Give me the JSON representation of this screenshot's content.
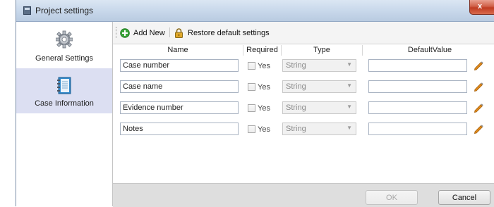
{
  "window": {
    "title": "Project settings",
    "close_label": "x"
  },
  "sidebar": {
    "items": [
      {
        "label": "General Settings",
        "icon": "gear-icon",
        "active": false
      },
      {
        "label": "Case Information",
        "icon": "notebook-icon",
        "active": true
      }
    ]
  },
  "toolbar": {
    "add_label": "Add New",
    "restore_label": "Restore default settings"
  },
  "grid": {
    "columns": [
      "Name",
      "Required",
      "Type",
      "DefaultValue"
    ],
    "rows": [
      {
        "name": "Case number",
        "required_label": "Yes",
        "type": "String",
        "default": ""
      },
      {
        "name": "Case name",
        "required_label": "Yes",
        "type": "String",
        "default": ""
      },
      {
        "name": "Evidence number",
        "required_label": "Yes",
        "type": "String",
        "default": ""
      },
      {
        "name": "Notes",
        "required_label": "Yes",
        "type": "String",
        "default": ""
      }
    ]
  },
  "footer": {
    "ok_label": "OK",
    "cancel_label": "Cancel"
  },
  "colors": {
    "accent_active": "#dcdff2",
    "add_icon": "#3aa53a",
    "pen": "#e08a1c",
    "titlebar": "#c7d7ea"
  }
}
